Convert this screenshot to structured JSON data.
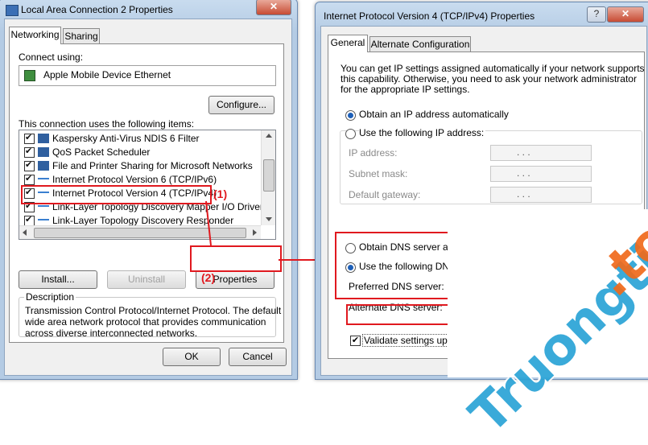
{
  "left_window": {
    "title": "Local Area Connection 2 Properties",
    "close_glyph": "✕",
    "tabs": [
      "Networking",
      "Sharing"
    ],
    "connect_using_label": "Connect using:",
    "adapter_name": "Apple Mobile Device Ethernet",
    "configure_label": "Configure...",
    "items_label": "This connection uses the following items:",
    "items": [
      "Kaspersky Anti-Virus NDIS 6 Filter",
      "QoS Packet Scheduler",
      "File and Printer Sharing for Microsoft Networks",
      "Internet Protocol Version 6 (TCP/IPv6)",
      "Internet Protocol Version 4 (TCP/IPv4)",
      "Link-Layer Topology Discovery Mapper I/O Driver",
      "Link-Layer Topology Discovery Responder"
    ],
    "install_label": "Install...",
    "uninstall_label": "Uninstall",
    "properties_label": "Properties",
    "description_label": "Description",
    "description_text_1": "Transmission Control Protocol/Internet Protocol. The default",
    "description_text_2": "wide area network protocol that provides communication",
    "description_text_3": "across diverse interconnected networks.",
    "ok_label": "OK",
    "cancel_label": "Cancel"
  },
  "right_window": {
    "title": "Internet Protocol Version 4 (TCP/IPv4) Properties",
    "help_glyph": "?",
    "close_glyph": "✕",
    "tabs": [
      "General",
      "Alternate Configuration"
    ],
    "intro_1": "You can get IP settings assigned automatically if your network supports",
    "intro_2": "this capability. Otherwise, you need to ask your network administrator",
    "intro_3": "for the appropriate IP settings.",
    "obtain_ip_auto": "Obtain an IP address automatically",
    "use_following_ip": "Use the following IP address:",
    "ip_address_label": "IP address:",
    "subnet_label": "Subnet mask:",
    "gateway_label": "Default gateway:",
    "ip_dots": ".    .    .",
    "obtain_dns_auto": "Obtain DNS server add",
    "use_following_dns": "Use the following DNS",
    "preferred_dns_label": "Preferred DNS server:",
    "alternate_dns_label": "Alternate DNS server:",
    "validate_label": "Validate settings upo"
  },
  "annotations": {
    "step1": "(1)",
    "step2": "(2)",
    "accent": "#e0191f"
  },
  "watermark": {
    "text_blue": "Truongtin",
    "text_orange": ".top"
  }
}
